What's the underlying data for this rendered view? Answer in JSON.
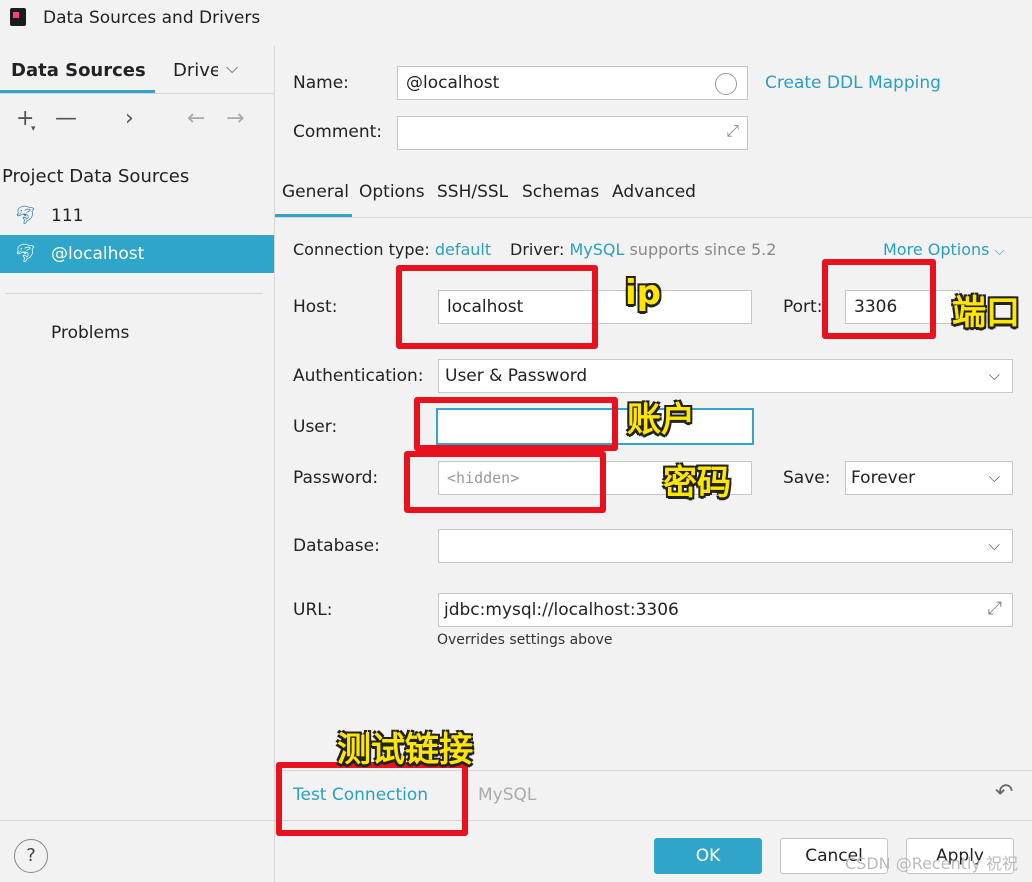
{
  "window": {
    "title": "Data Sources and Drivers"
  },
  "left": {
    "tabs": [
      "Data Sources",
      "Drivers"
    ],
    "section_title": "Project Data Sources",
    "items": [
      {
        "label": "111",
        "icon": "mysql-dolphin-icon"
      },
      {
        "label": "@localhost",
        "icon": "mysql-dolphin-icon",
        "selected": true
      }
    ],
    "problems": "Problems"
  },
  "form": {
    "name_label": "Name:",
    "name_value": "@localhost",
    "create_ddl": "Create DDL Mapping",
    "comment_label": "Comment:",
    "comment_value": "",
    "tabs": [
      "General",
      "Options",
      "SSH/SSL",
      "Schemas",
      "Advanced"
    ],
    "conn_type_label": "Connection type:",
    "conn_type_value": "default",
    "driver_label": "Driver:",
    "driver_value": "MySQL",
    "driver_suffix": "supports since 5.2",
    "more_options": "More Options",
    "host_label": "Host:",
    "host_value": "localhost",
    "port_label": "Port:",
    "port_value": "3306",
    "auth_label": "Authentication:",
    "auth_value": "User & Password",
    "user_label": "User:",
    "user_value": "",
    "password_label": "Password:",
    "password_placeholder": "<hidden>",
    "save_label": "Save:",
    "save_value": "Forever",
    "database_label": "Database:",
    "database_value": "",
    "url_label": "URL:",
    "url_value": "jdbc:mysql://localhost:3306",
    "url_hint": "Overrides settings above"
  },
  "bottom": {
    "test_connection": "Test Connection",
    "driver_name": "MySQL"
  },
  "footer": {
    "help": "?",
    "ok": "OK",
    "cancel": "Cancel",
    "apply": "Apply"
  },
  "annotations": {
    "ip": "ip",
    "port": "端口",
    "user": "账户",
    "password": "密码",
    "test": "测试链接"
  },
  "watermark": "CSDN @Recently 祝祝",
  "colors": {
    "accent": "#2fa6c9",
    "annotation_red": "#e8121f",
    "annotation_text": "#ffe600"
  }
}
